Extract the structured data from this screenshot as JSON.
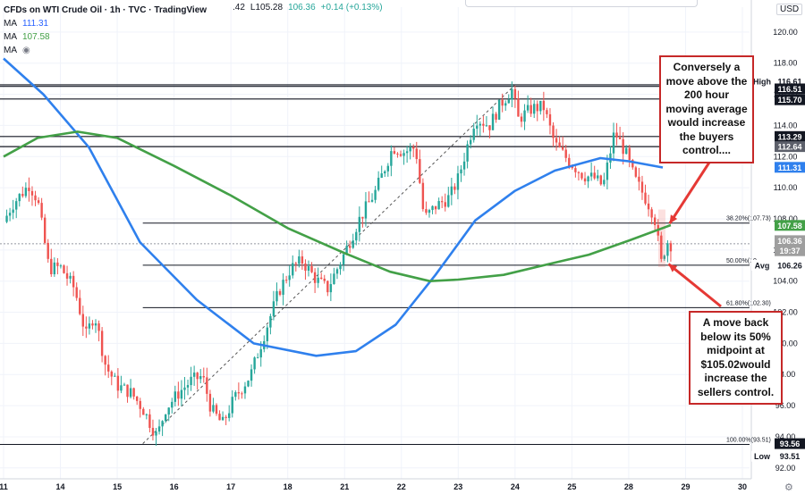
{
  "header": {
    "symbol": "CFDs on WTI Crude Oil · 1h · TVC · TradingView",
    "ohlc_fragment": ".42",
    "low_fragment": "L105.28",
    "close_fragment": "106.36",
    "change": "+0.14 (+0.13%)",
    "ma1_label": "MA",
    "ma1_value": "111.31",
    "ma2_label": "MA",
    "ma2_value": "107.58",
    "ma3_label": "MA",
    "currency": "USD"
  },
  "colors": {
    "up": "#26a69a",
    "down": "#ef5350",
    "ma100": "#2f80ed",
    "ma200": "#43a047",
    "fib": "#131722",
    "annotation_border": "#c62828",
    "arrow": "#e53935"
  },
  "annotations": {
    "top_note": "Conversely a move above the 200 hour moving average would increase the buyers control....",
    "bottom_note": "A move back below its 50% midpoint at $105.02would increase the sellers control."
  },
  "chart_data": {
    "type": "candlestick",
    "title": "CFDs on WTI Crude Oil, 1h, TVC",
    "y_ticks": [
      120,
      118,
      116,
      114,
      112,
      110,
      108,
      106,
      104,
      102,
      100,
      98,
      96,
      94,
      92
    ],
    "ylim": [
      91.3,
      121.6
    ],
    "x_ticks": [
      {
        "label": "11",
        "x": 0
      },
      {
        "label": "14",
        "x": 1
      },
      {
        "label": "15",
        "x": 2
      },
      {
        "label": "16",
        "x": 3
      },
      {
        "label": "17",
        "x": 4
      },
      {
        "label": "18",
        "x": 5
      },
      {
        "label": "21",
        "x": 6
      },
      {
        "label": "22",
        "x": 7
      },
      {
        "label": "23",
        "x": 8
      },
      {
        "label": "24",
        "x": 9
      },
      {
        "label": "25",
        "x": 10
      },
      {
        "label": "28",
        "x": 11
      },
      {
        "label": "29",
        "x": 12
      },
      {
        "label": "30",
        "x": 13
      }
    ],
    "price_path": [
      [
        0.0,
        107.8
      ],
      [
        0.15,
        108.9
      ],
      [
        0.45,
        110.2
      ],
      [
        0.6,
        109.2
      ],
      [
        0.8,
        104.8
      ],
      [
        1.0,
        104.9
      ],
      [
        1.25,
        103.5
      ],
      [
        1.45,
        100.5
      ],
      [
        1.6,
        101.9
      ],
      [
        1.8,
        98.5
      ],
      [
        2.0,
        97.3
      ],
      [
        2.25,
        96.8
      ],
      [
        2.45,
        95.8
      ],
      [
        2.7,
        94.0
      ],
      [
        2.85,
        95.8
      ],
      [
        3.1,
        96.9
      ],
      [
        3.3,
        97.6
      ],
      [
        3.5,
        97.9
      ],
      [
        3.65,
        95.8
      ],
      [
        3.85,
        94.8
      ],
      [
        4.05,
        96.4
      ],
      [
        4.35,
        98.0
      ],
      [
        4.55,
        100.2
      ],
      [
        4.85,
        103.4
      ],
      [
        5.05,
        104.8
      ],
      [
        5.25,
        105.3
      ],
      [
        5.5,
        104.1
      ],
      [
        5.7,
        103.5
      ],
      [
        6.0,
        105.8
      ],
      [
        6.25,
        107.9
      ],
      [
        6.55,
        109.8
      ],
      [
        6.85,
        112.6
      ],
      [
        7.05,
        112.3
      ],
      [
        7.25,
        112.6
      ],
      [
        7.4,
        108.0
      ],
      [
        7.6,
        108.8
      ],
      [
        7.85,
        109.4
      ],
      [
        8.0,
        110.6
      ],
      [
        8.3,
        114.5
      ],
      [
        8.55,
        114.0
      ],
      [
        8.75,
        115.4
      ],
      [
        8.95,
        116.3
      ],
      [
        9.05,
        114.4
      ],
      [
        9.3,
        115.1
      ],
      [
        9.5,
        115.2
      ],
      [
        9.7,
        112.8
      ],
      [
        9.95,
        111.7
      ],
      [
        10.2,
        110.8
      ],
      [
        10.4,
        110.6
      ],
      [
        10.55,
        110.1
      ],
      [
        10.75,
        113.6
      ],
      [
        10.95,
        112.2
      ],
      [
        11.1,
        110.6
      ],
      [
        11.3,
        109.3
      ],
      [
        11.45,
        108.2
      ],
      [
        11.58,
        105.0
      ],
      [
        11.66,
        106.6
      ],
      [
        11.74,
        106.36
      ]
    ],
    "series": [
      {
        "name": "MA 111.31",
        "points": [
          [
            0,
            118.3
          ],
          [
            0.7,
            116.0
          ],
          [
            1.5,
            112.6
          ],
          [
            2.4,
            106.5
          ],
          [
            3.4,
            102.8
          ],
          [
            4.4,
            100.0
          ],
          [
            5.5,
            99.2
          ],
          [
            6.2,
            99.5
          ],
          [
            6.9,
            101.2
          ],
          [
            7.6,
            104.4
          ],
          [
            8.3,
            107.9
          ],
          [
            9.0,
            109.8
          ],
          [
            9.7,
            111.1
          ],
          [
            10.5,
            111.9
          ],
          [
            11.0,
            111.7
          ],
          [
            11.6,
            111.3
          ]
        ]
      },
      {
        "name": "MA 107.58",
        "points": [
          [
            0,
            112.0
          ],
          [
            0.6,
            113.2
          ],
          [
            1.3,
            113.6
          ],
          [
            2.0,
            113.2
          ],
          [
            3.0,
            111.4
          ],
          [
            4.0,
            109.5
          ],
          [
            5.0,
            107.4
          ],
          [
            6.0,
            105.8
          ],
          [
            6.8,
            104.6
          ],
          [
            7.5,
            104.0
          ],
          [
            8.0,
            104.1
          ],
          [
            8.8,
            104.4
          ],
          [
            9.6,
            105.1
          ],
          [
            10.3,
            105.7
          ],
          [
            11.0,
            106.6
          ],
          [
            11.74,
            107.6
          ]
        ]
      }
    ],
    "fibonacci": [
      {
        "label": "38.20%(107.73)",
        "price": 107.73
      },
      {
        "label": "50.00%(10",
        "price": 105.02
      },
      {
        "label": "61.80%(102.30)",
        "price": 102.3
      },
      {
        "label": "100.00%(93.51)",
        "price": 93.51
      }
    ],
    "horizontal_lines": [
      116.61,
      116.51,
      115.7,
      113.29,
      112.64
    ],
    "trend_line": [
      [
        2.45,
        93.56
      ],
      [
        9.0,
        116.61
      ]
    ],
    "price_scale_labels": [
      {
        "text": "High",
        "price": 116.85
      },
      {
        "text": "116.61",
        "price": 116.85
      },
      {
        "text": "116.51",
        "price": 116.35
      },
      {
        "text": "115.70",
        "price": 115.65
      },
      {
        "text": "113.29",
        "price": 113.29
      },
      {
        "text": "112.64",
        "price": 112.64
      },
      {
        "text": "111.31",
        "price": 111.31
      },
      {
        "text": "107.58",
        "price": 107.58
      },
      {
        "text": "106.36",
        "price": 106.6
      },
      {
        "text": "19:37",
        "price": 105.95
      },
      {
        "text": "Avg",
        "price": 105.02
      },
      {
        "text": "106.26",
        "price": 105.02
      },
      {
        "text": "93.56",
        "price": 93.56
      },
      {
        "text": "93.51",
        "price": 92.75
      },
      {
        "text": "Low",
        "price": 92.75
      }
    ]
  }
}
